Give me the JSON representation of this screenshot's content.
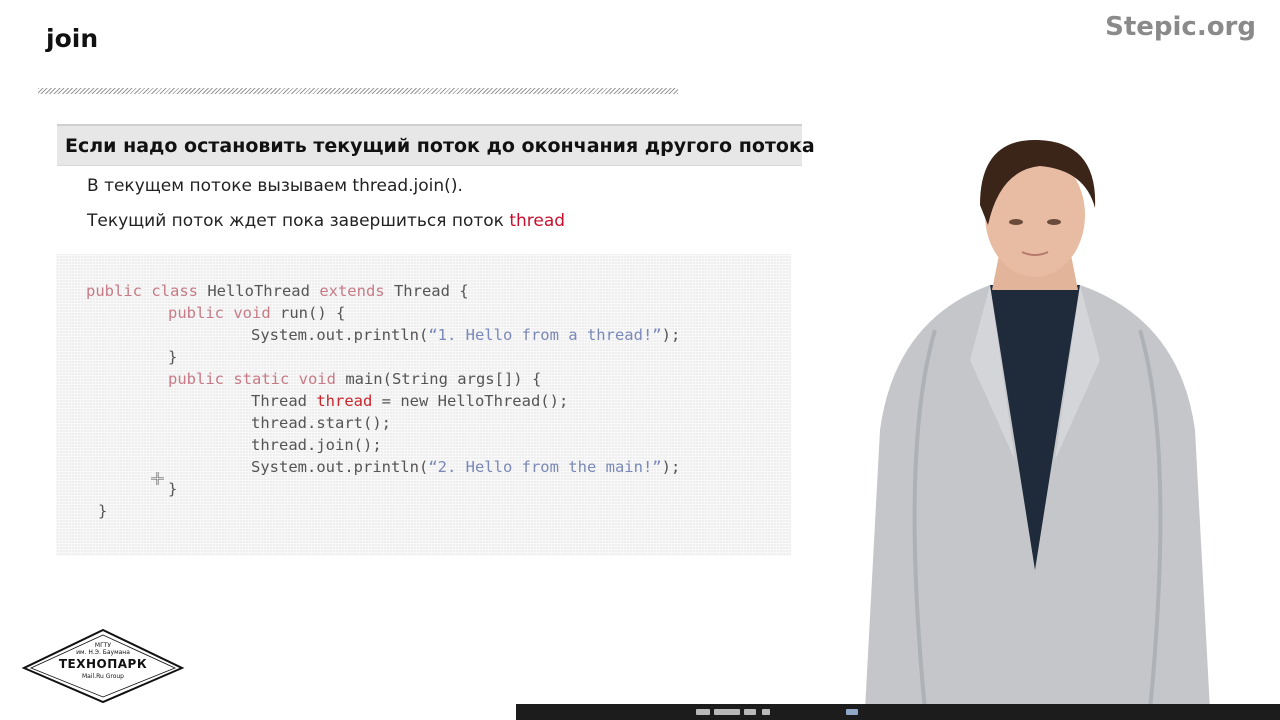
{
  "slide": {
    "title": "join",
    "brand": "Stepic.org",
    "heading": "Если надо остановить текущий поток до окончания другого потока",
    "bullet1": "В текущем потоке вызываем thread.join().",
    "bullet2_text": "Текущий поток ждет пока завершиться поток ",
    "bullet2_highlight": "thread"
  },
  "code": {
    "line1": {
      "kw1": "public class",
      "t1": " HelloThread ",
      "kw2": "extends",
      "t2": " Thread {"
    },
    "line2": {
      "kw1": "public void",
      "t1": " run() {"
    },
    "line3": {
      "t1": "System.out.println(",
      "str": "“1. Hello from a thread!”",
      "t2": ");"
    },
    "line4": "}",
    "line5": {
      "kw1": "public static void",
      "t1": " main(String args[]) {"
    },
    "line6": {
      "t1": "Thread ",
      "var": "thread",
      "t2": " = new HelloThread();"
    },
    "line7": "thread.start();",
    "line8": "thread.join();",
    "line9": {
      "t1": "System.out.println(",
      "str": "“2. Hello from the main!”",
      "t2": ");"
    },
    "line10": "}",
    "line11": "}"
  },
  "logo": {
    "line1": "МГТУ",
    "line2": "им. Н.Э. Баумана",
    "name": "ТЕХНОПАРК",
    "line3": "Mail.Ru Group"
  },
  "colors": {
    "accent": "#c8102e",
    "keyword": "#c77b86",
    "string": "#7a89b8",
    "brand": "#8a8a8a"
  },
  "icons": [
    "move-cursor-icon"
  ]
}
